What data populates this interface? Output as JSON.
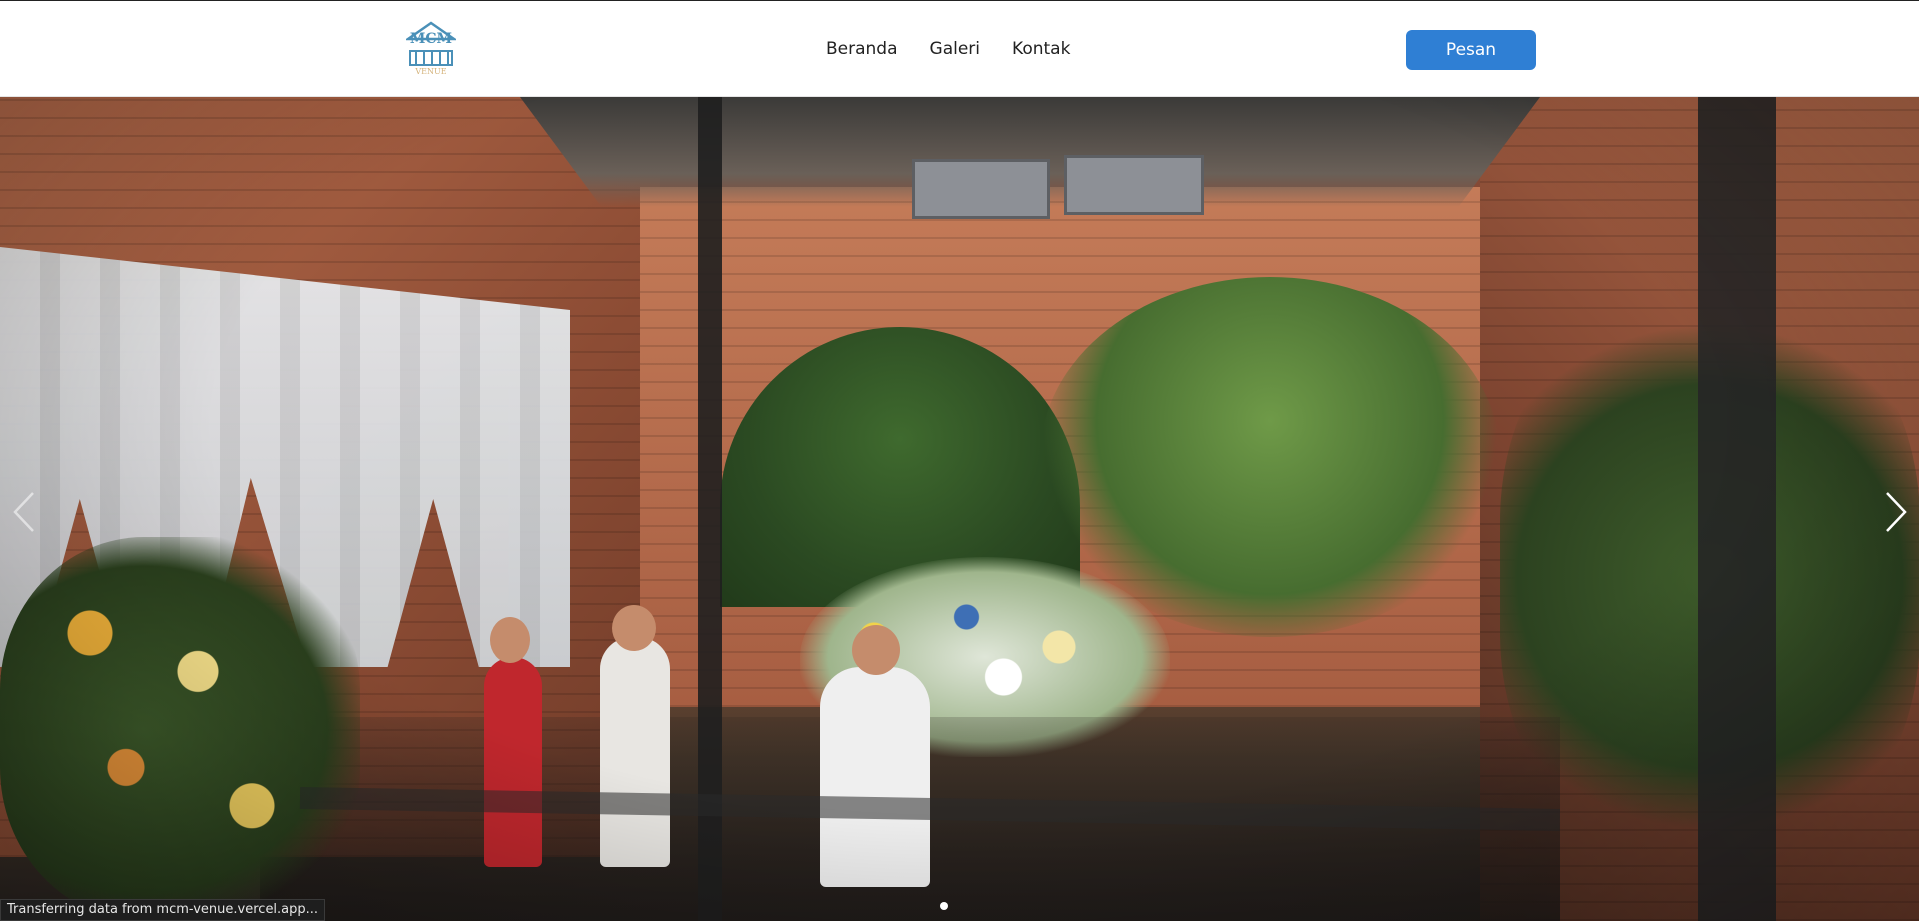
{
  "header": {
    "logo": {
      "text_top": "MCM",
      "text_bottom": "VENUE"
    },
    "nav": [
      {
        "label": "Beranda"
      },
      {
        "label": "Galeri"
      },
      {
        "label": "Kontak"
      }
    ],
    "cta_label": "Pesan"
  },
  "hero": {
    "prev_icon": "chevron-left-icon",
    "next_icon": "chevron-right-icon",
    "active_slide_index": 0,
    "slide_count": 1
  },
  "status_bar": {
    "text": "Transferring data from mcm-venue.vercel.app..."
  },
  "colors": {
    "accent": "#2f7fd4",
    "logo": "#4a90b8",
    "logo_text": "#d4b27a"
  }
}
